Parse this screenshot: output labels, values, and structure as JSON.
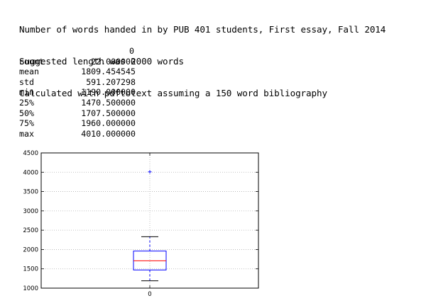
{
  "header": {
    "line1": "Number of words handed in by PUB 401 students, First essay, Fall 2014",
    "line2": "Suggested length was 2000 words",
    "line3": "Calculated with pdftotext assuming a 150 word bibliography"
  },
  "stats": {
    "column_header": "0",
    "rows": [
      {
        "name": "count",
        "value": "22.000000"
      },
      {
        "name": "mean",
        "value": "1809.454545"
      },
      {
        "name": "std",
        "value": "591.207298"
      },
      {
        "name": "min",
        "value": "1190.000000"
      },
      {
        "name": "25%",
        "value": "1470.500000"
      },
      {
        "name": "50%",
        "value": "1707.500000"
      },
      {
        "name": "75%",
        "value": "1960.000000"
      },
      {
        "name": "max",
        "value": "4010.000000"
      }
    ]
  },
  "chart_data": {
    "type": "box",
    "categories": [
      "0"
    ],
    "boxes": [
      {
        "category": "0",
        "whisker_low": 1190,
        "q1": 1470.5,
        "median": 1707.5,
        "q3": 1960,
        "whisker_high": 2330,
        "outliers": [
          4010
        ]
      }
    ],
    "ylim": [
      1000,
      4500
    ],
    "yticks": [
      1000,
      1500,
      2000,
      2500,
      3000,
      3500,
      4000,
      4500
    ],
    "grid": true,
    "title": "",
    "xlabel": "",
    "ylabel": "",
    "colors": {
      "box": "#0000ff",
      "median": "#ff0000",
      "whisker": "#0000ff",
      "caps": "#000000",
      "outlier": "#0000ff",
      "grid": "#b0b0b0"
    }
  }
}
